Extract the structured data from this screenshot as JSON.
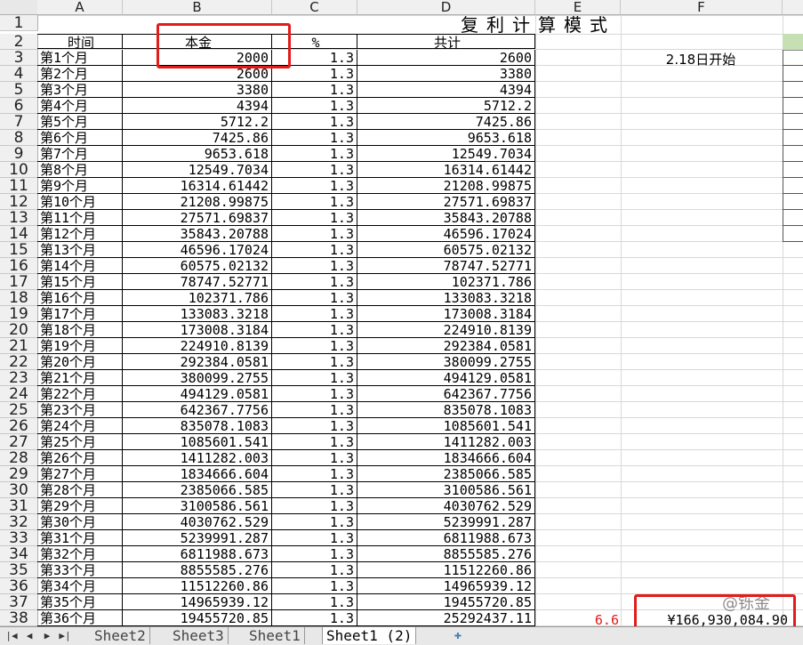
{
  "column_headers": [
    "A",
    "B",
    "C",
    "D",
    "E",
    "F"
  ],
  "title": "复利计算模式",
  "headers": {
    "time": "时间",
    "principal": "本金",
    "percent": "%",
    "total": "共计"
  },
  "note": "2.18日开始",
  "rows": [
    {
      "r": "3",
      "label": "第1个月",
      "principal": "2000",
      "pct": "1.3",
      "total": "2600"
    },
    {
      "r": "4",
      "label": "第2个月",
      "principal": "2600",
      "pct": "1.3",
      "total": "3380"
    },
    {
      "r": "5",
      "label": "第3个月",
      "principal": "3380",
      "pct": "1.3",
      "total": "4394"
    },
    {
      "r": "6",
      "label": "第4个月",
      "principal": "4394",
      "pct": "1.3",
      "total": "5712.2"
    },
    {
      "r": "7",
      "label": "第5个月",
      "principal": "5712.2",
      "pct": "1.3",
      "total": "7425.86"
    },
    {
      "r": "8",
      "label": "第6个月",
      "principal": "7425.86",
      "pct": "1.3",
      "total": "9653.618"
    },
    {
      "r": "9",
      "label": "第7个月",
      "principal": "9653.618",
      "pct": "1.3",
      "total": "12549.7034"
    },
    {
      "r": "10",
      "label": "第8个月",
      "principal": "12549.7034",
      "pct": "1.3",
      "total": "16314.61442"
    },
    {
      "r": "11",
      "label": "第9个月",
      "principal": "16314.61442",
      "pct": "1.3",
      "total": "21208.99875"
    },
    {
      "r": "12",
      "label": "第10个月",
      "principal": "21208.99875",
      "pct": "1.3",
      "total": "27571.69837"
    },
    {
      "r": "13",
      "label": "第11个月",
      "principal": "27571.69837",
      "pct": "1.3",
      "total": "35843.20788"
    },
    {
      "r": "14",
      "label": "第12个月",
      "principal": "35843.20788",
      "pct": "1.3",
      "total": "46596.17024"
    },
    {
      "r": "15",
      "label": "第13个月",
      "principal": "46596.17024",
      "pct": "1.3",
      "total": "60575.02132"
    },
    {
      "r": "16",
      "label": "第14个月",
      "principal": "60575.02132",
      "pct": "1.3",
      "total": "78747.52771"
    },
    {
      "r": "17",
      "label": "第15个月",
      "principal": "78747.52771",
      "pct": "1.3",
      "total": "102371.786"
    },
    {
      "r": "18",
      "label": "第16个月",
      "principal": "102371.786",
      "pct": "1.3",
      "total": "133083.3218"
    },
    {
      "r": "19",
      "label": "第17个月",
      "principal": "133083.3218",
      "pct": "1.3",
      "total": "173008.3184"
    },
    {
      "r": "20",
      "label": "第18个月",
      "principal": "173008.3184",
      "pct": "1.3",
      "total": "224910.8139"
    },
    {
      "r": "21",
      "label": "第19个月",
      "principal": "224910.8139",
      "pct": "1.3",
      "total": "292384.0581"
    },
    {
      "r": "22",
      "label": "第20个月",
      "principal": "292384.0581",
      "pct": "1.3",
      "total": "380099.2755"
    },
    {
      "r": "23",
      "label": "第21个月",
      "principal": "380099.2755",
      "pct": "1.3",
      "total": "494129.0581"
    },
    {
      "r": "24",
      "label": "第22个月",
      "principal": "494129.0581",
      "pct": "1.3",
      "total": "642367.7756"
    },
    {
      "r": "25",
      "label": "第23个月",
      "principal": "642367.7756",
      "pct": "1.3",
      "total": "835078.1083"
    },
    {
      "r": "26",
      "label": "第24个月",
      "principal": "835078.1083",
      "pct": "1.3",
      "total": "1085601.541"
    },
    {
      "r": "27",
      "label": "第25个月",
      "principal": "1085601.541",
      "pct": "1.3",
      "total": "1411282.003"
    },
    {
      "r": "28",
      "label": "第26个月",
      "principal": "1411282.003",
      "pct": "1.3",
      "total": "1834666.604"
    },
    {
      "r": "29",
      "label": "第27个月",
      "principal": "1834666.604",
      "pct": "1.3",
      "total": "2385066.585"
    },
    {
      "r": "30",
      "label": "第28个月",
      "principal": "2385066.585",
      "pct": "1.3",
      "total": "3100586.561"
    },
    {
      "r": "31",
      "label": "第29个月",
      "principal": "3100586.561",
      "pct": "1.3",
      "total": "4030762.529"
    },
    {
      "r": "32",
      "label": "第30个月",
      "principal": "4030762.529",
      "pct": "1.3",
      "total": "5239991.287"
    },
    {
      "r": "33",
      "label": "第31个月",
      "principal": "5239991.287",
      "pct": "1.3",
      "total": "6811988.673"
    },
    {
      "r": "34",
      "label": "第32个月",
      "principal": "6811988.673",
      "pct": "1.3",
      "total": "8855585.276"
    },
    {
      "r": "35",
      "label": "第33个月",
      "principal": "8855585.276",
      "pct": "1.3",
      "total": "11512260.86"
    },
    {
      "r": "36",
      "label": "第34个月",
      "principal": "11512260.86",
      "pct": "1.3",
      "total": "14965939.12"
    },
    {
      "r": "37",
      "label": "第35个月",
      "principal": "14965939.12",
      "pct": "1.3",
      "total": "19455720.85"
    },
    {
      "r": "38",
      "label": "第36个月",
      "principal": "19455720.85",
      "pct": "1.3",
      "total": "25292437.11"
    }
  ],
  "ratio_value": "6.6",
  "total_value": "¥166,930,084.90",
  "watermark": "@铄金",
  "tabs": [
    "Sheet2",
    "Sheet3",
    "Sheet1",
    "Sheet1 (2)"
  ],
  "active_tab": "Sheet1 (2)",
  "colors": {
    "highlight_red": "#e21b1b",
    "green_fill": "#c6e0b4"
  }
}
